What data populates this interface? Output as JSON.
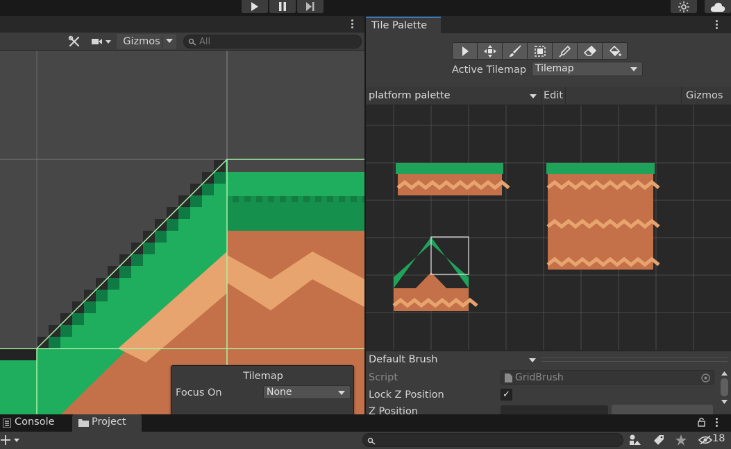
{
  "toolbar": {
    "play_icon": "play-icon",
    "pause_icon": "pause-icon",
    "step_icon": "step-icon"
  },
  "scene": {
    "gizmos_label": "Gizmos",
    "search_placeholder": "All",
    "tilemap_overlay": {
      "title": "Tilemap",
      "focus_label": "Focus On",
      "focus_value": "None"
    },
    "colors": {
      "grass_dark": "#0f7a44",
      "grass_light": "#1fae5e",
      "dirt": "#c4714a",
      "dirt_light": "#e8a46e",
      "selection_outline": "#a9f2a6"
    }
  },
  "palette": {
    "tab_label": "Tile Palette",
    "tools": [
      "select-tool",
      "move-tool",
      "paint-tool",
      "box-fill-tool",
      "pick-tool",
      "erase-tool",
      "flood-fill-tool"
    ],
    "active_tilemap_label": "Active Tilemap",
    "active_tilemap_value": "Tilemap",
    "palette_name": "platform palette",
    "edit_label": "Edit",
    "gizmos_label": "Gizmos",
    "brush_name": "Default Brush",
    "properties": {
      "script_label": "Script",
      "script_value": "GridBrush",
      "lock_z_label": "Lock Z Position",
      "lock_z_checked": "✓",
      "z_position_label": "Z Position"
    }
  },
  "bottom": {
    "console_label": "Console",
    "project_label": "Project",
    "hidden_count": "18"
  }
}
